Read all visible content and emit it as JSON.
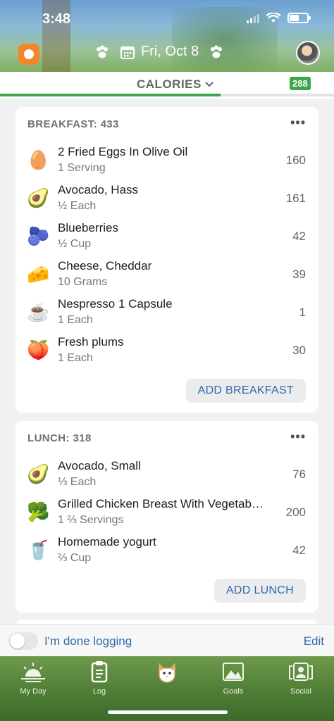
{
  "status_bar": {
    "time": "3:48"
  },
  "header": {
    "date": "Fri, Oct 8"
  },
  "calories_bar": {
    "label": "CALORIES",
    "remaining": "288",
    "progress_fraction": 0.66,
    "colors": {
      "progress": "#3fa54a",
      "track": "#e3e3e3"
    }
  },
  "breakfast": {
    "title": "BREAKFAST: 433",
    "more": "•••",
    "items": [
      {
        "icon": "egg-icon",
        "emoji": "🥚",
        "name": "2 Fried Eggs In Olive Oil",
        "portion": "1 Serving",
        "cal": "160"
      },
      {
        "icon": "avocado-icon",
        "emoji": "🥑",
        "name": "Avocado, Hass",
        "portion": "½ Each",
        "cal": "161"
      },
      {
        "icon": "blueberries-icon",
        "emoji": "🫐",
        "name": "Blueberries",
        "portion": "½ Cup",
        "cal": "42"
      },
      {
        "icon": "cheese-icon",
        "emoji": "🧀",
        "name": "Cheese, Cheddar",
        "portion": "10 Grams",
        "cal": "39"
      },
      {
        "icon": "coffee-icon",
        "emoji": "☕",
        "name": "Nespresso 1 Capsule",
        "portion": "1 Each",
        "cal": "1"
      },
      {
        "icon": "plum-icon",
        "emoji": "🍑",
        "name": "Fresh plums",
        "portion": "1 Each",
        "cal": "30"
      }
    ],
    "add_label": "ADD BREAKFAST"
  },
  "lunch": {
    "title": "LUNCH: 318",
    "more": "•••",
    "items": [
      {
        "icon": "avocado-icon",
        "emoji": "🥑",
        "name": "Avocado, Small",
        "portion": "⅓ Each",
        "cal": "76"
      },
      {
        "icon": "broccoli-icon",
        "emoji": "🥦",
        "name": "Grilled Chicken Breast With Vegetab…",
        "portion": "1 ⅔ Servings",
        "cal": "200"
      },
      {
        "icon": "yogurt-icon",
        "emoji": "🥤",
        "name": "Homemade yogurt",
        "portion": "⅔ Cup",
        "cal": "42"
      }
    ],
    "add_label": "ADD LUNCH"
  },
  "footer": {
    "done_label": "I'm done logging",
    "edit_label": "Edit",
    "done_toggle_on": false
  },
  "tabs": [
    {
      "label": "My Day",
      "icon": "sunrise-icon"
    },
    {
      "label": "Log",
      "icon": "clipboard-icon"
    },
    {
      "label": "",
      "icon": "cat-icon"
    },
    {
      "label": "Goals",
      "icon": "mountain-icon"
    },
    {
      "label": "Social",
      "icon": "social-icon"
    }
  ]
}
